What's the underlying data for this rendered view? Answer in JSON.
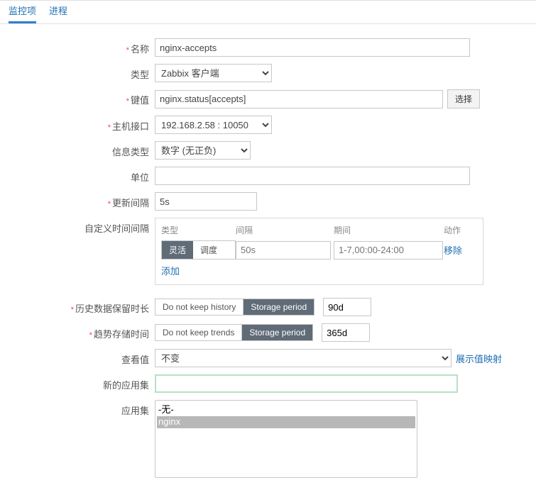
{
  "tabs": {
    "active": "监控项",
    "other": "进程"
  },
  "form": {
    "name": {
      "label": "名称",
      "value": "nginx-accepts",
      "required": true
    },
    "type": {
      "label": "类型",
      "value": "Zabbix 客户端"
    },
    "key": {
      "label": "键值",
      "value": "nginx.status[accepts]",
      "select_btn": "选择",
      "required": true
    },
    "iface": {
      "label": "主机接口",
      "value": "192.168.2.58 : 10050",
      "required": true
    },
    "info": {
      "label": "信息类型",
      "value": "数字 (无正负)"
    },
    "unit": {
      "label": "单位",
      "value": ""
    },
    "interval": {
      "label": "更新间隔",
      "value": "5s",
      "required": true
    },
    "custom_intv": {
      "label": "自定义时间间隔",
      "header_type": "类型",
      "header_gap": "间隔",
      "header_period": "期间",
      "header_action": "动作",
      "toggle_on": "灵活",
      "toggle_off": "调度",
      "gap_placeholder": "50s",
      "period_placeholder": "1-7,00:00-24:00",
      "remove": "移除",
      "add": "添加"
    },
    "history": {
      "label": "历史数据保留时长",
      "no_keep": "Do not keep history",
      "storage": "Storage period",
      "value": "90d",
      "required": true
    },
    "trends": {
      "label": "趋势存储时间",
      "no_keep": "Do not keep trends",
      "storage": "Storage period",
      "value": "365d",
      "required": true
    },
    "show_value": {
      "label": "查看值",
      "value": "不变",
      "link": "展示值映射"
    },
    "new_app": {
      "label": "新的应用集"
    },
    "apps": {
      "label": "应用集",
      "none": "-无-",
      "opt1": "nginx"
    }
  }
}
